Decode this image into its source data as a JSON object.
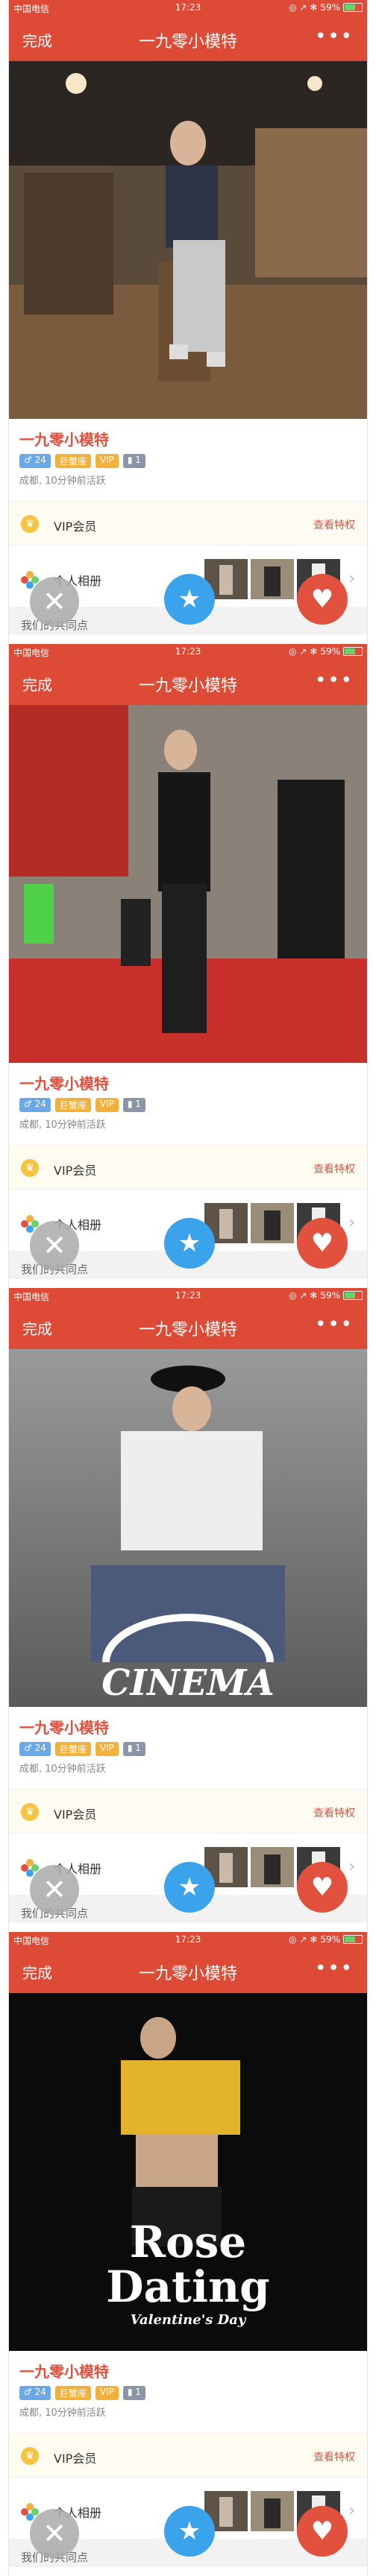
{
  "status": {
    "carrier": "中国电信",
    "time": "17:23",
    "icons": "◎ ↗ ✻",
    "battery": "59%"
  },
  "nav": {
    "done": "完成",
    "title": "一九零小模特",
    "more": "•••"
  },
  "profile": {
    "name": "一九零小模特",
    "age": "♂ 24",
    "tag_lazy": "巨蟹座",
    "tag_vip": "VIP",
    "tag_level": "▮ 1",
    "location": "成都, 10分钟前活跃"
  },
  "vip": {
    "label": "VIP会员",
    "link": "查看特权",
    "icon": "crown-icon"
  },
  "album": {
    "label": "个人相册",
    "chevron": "›"
  },
  "common_label": "我们的共同点",
  "buttons": {
    "dislike": "✕",
    "superlike": "★",
    "like": "♥"
  },
  "overlays": {
    "cinema": "CINEMA",
    "rose1": "Rose",
    "rose2": "Dating",
    "rose3": "Valentine's Day"
  },
  "colors": {
    "brand": "#dd4a35",
    "accent": "#e2513d",
    "star": "#3aa3ec"
  }
}
